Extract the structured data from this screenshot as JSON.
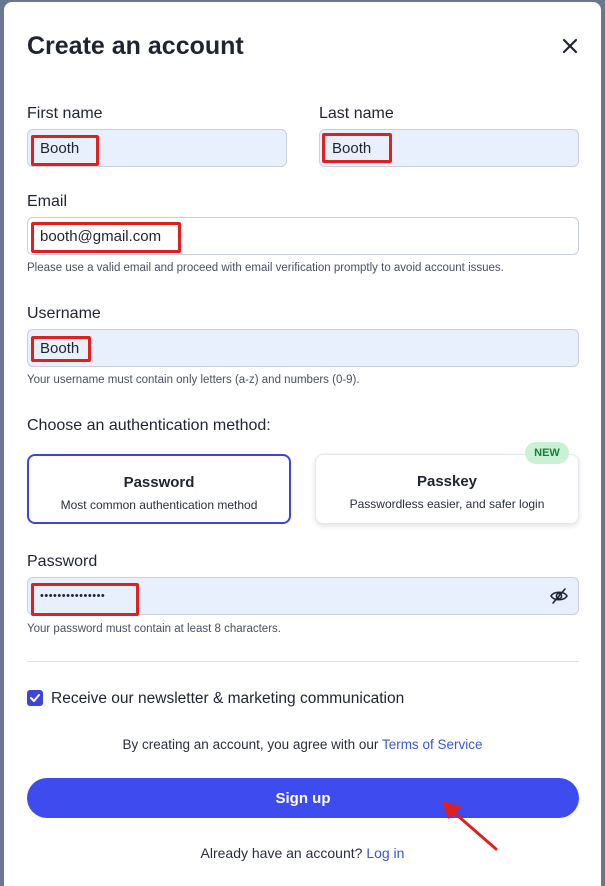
{
  "modal": {
    "title": "Create an account"
  },
  "form": {
    "first_name": {
      "label": "First name",
      "value": "Booth"
    },
    "last_name": {
      "label": "Last name",
      "value": "Booth"
    },
    "email": {
      "label": "Email",
      "value": "booth@gmail.com",
      "hint": "Please use a valid email and proceed with email verification promptly to avoid account issues."
    },
    "username": {
      "label": "Username",
      "value": "Booth",
      "hint": "Your username must contain only letters (a-z) and numbers (0-9)."
    },
    "auth": {
      "label": "Choose an authentication method:",
      "options": [
        {
          "title": "Password",
          "subtitle": "Most common authentication method",
          "selected": true
        },
        {
          "title": "Passkey",
          "subtitle": "Passwordless easier, and safer login",
          "selected": false,
          "badge": "NEW"
        }
      ]
    },
    "password": {
      "label": "Password",
      "value": "•••••••••••••••",
      "hint": "Your password must contain at least 8 characters."
    },
    "newsletter": {
      "label": "Receive our newsletter & marketing communication",
      "checked": true
    },
    "terms": {
      "prefix": "By creating an account, you agree with our",
      "link": "Terms of Service"
    },
    "submit_label": "Sign up",
    "login": {
      "prefix": "Already have an account?",
      "link": "Log in"
    }
  },
  "colors": {
    "accent": "#3d4bef",
    "field_bg": "#e9f0fd",
    "annotation_red": "#e02020",
    "badge_bg": "#c9f2d4",
    "badge_text": "#16803a"
  },
  "icons": [
    "close-icon",
    "eye-off-icon",
    "check-icon",
    "annotation-arrow"
  ]
}
